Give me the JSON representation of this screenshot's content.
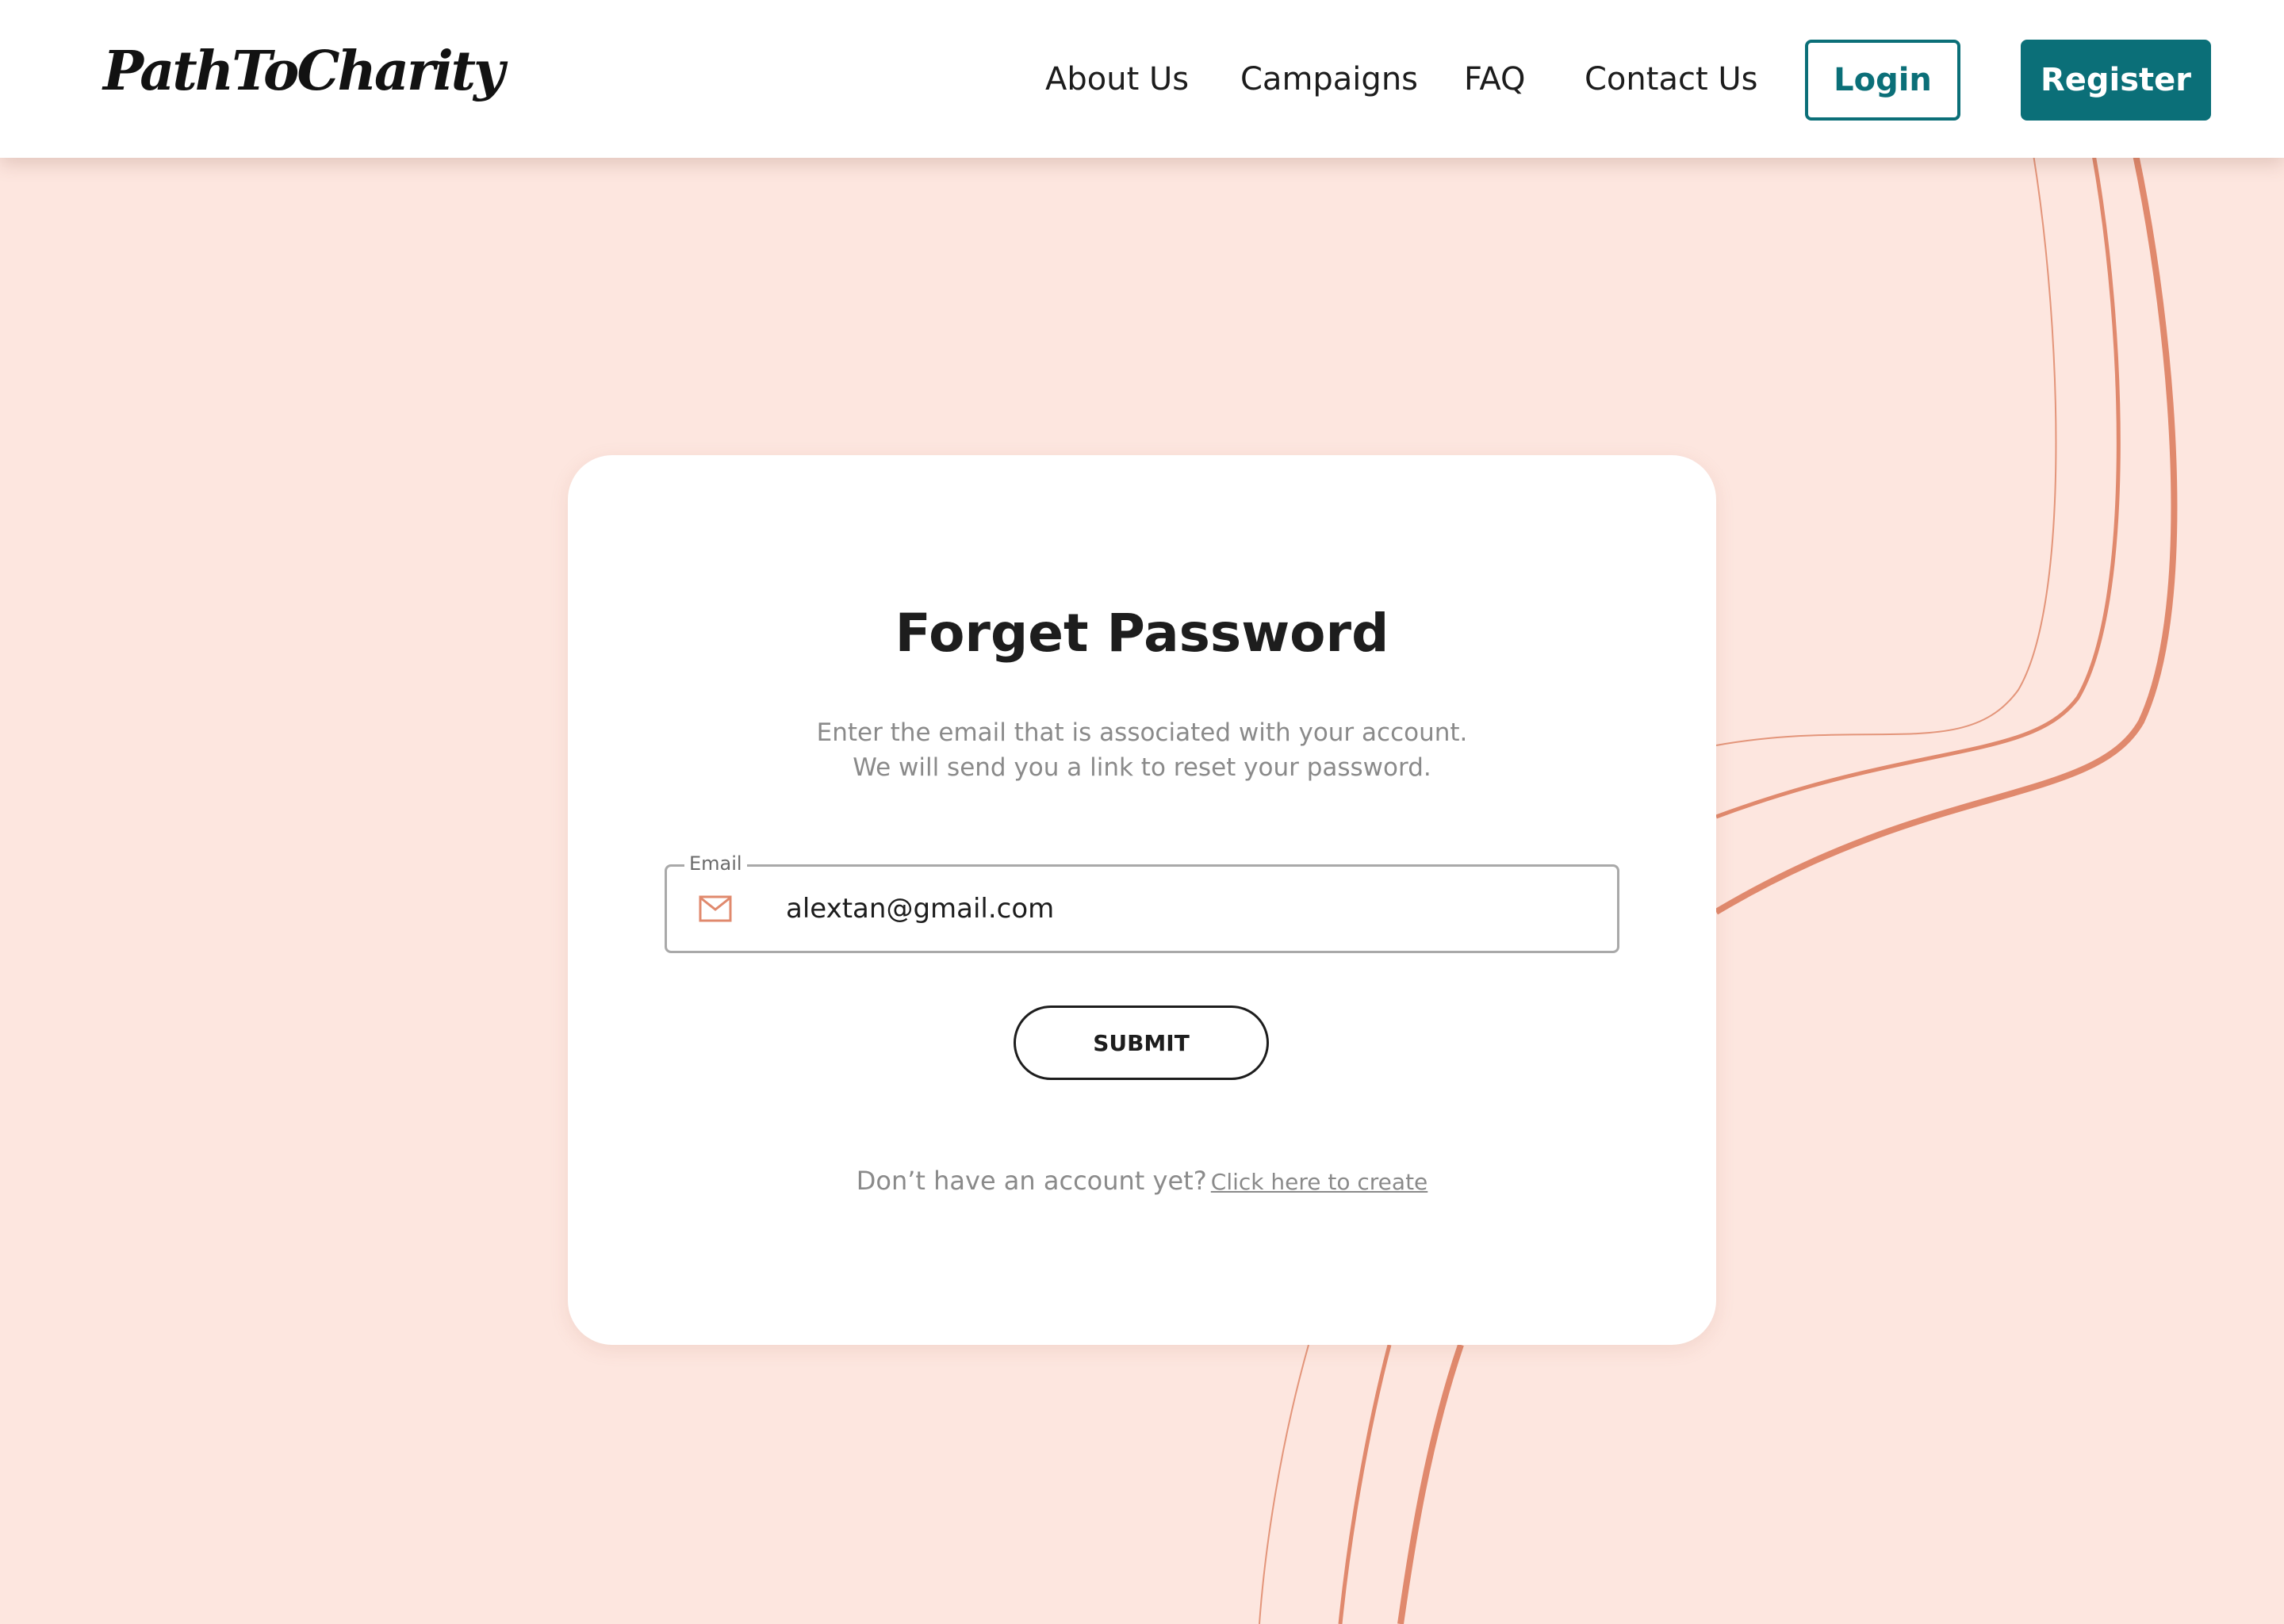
{
  "header": {
    "logo": "PathToCharity",
    "nav": [
      {
        "label": "About Us"
      },
      {
        "label": "Campaigns"
      },
      {
        "label": "FAQ"
      },
      {
        "label": "Contact Us"
      }
    ],
    "login_label": "Login",
    "register_label": "Register"
  },
  "card": {
    "title": "Forget Password",
    "description_line1": "Enter the email that is associated with your account.",
    "description_line2": "We will send you a link to reset your password.",
    "email": {
      "label": "Email",
      "value": "alextan@gmail.com",
      "icon": "mail-icon"
    },
    "submit_label": "SUBMIT",
    "signup_prompt": "Don’t have an account yet?",
    "signup_link": "Click here to create"
  },
  "colors": {
    "background": "#fde6df",
    "accent": "#0b6f78",
    "curve": "#e0896d",
    "text_muted": "#8a8a8a"
  }
}
